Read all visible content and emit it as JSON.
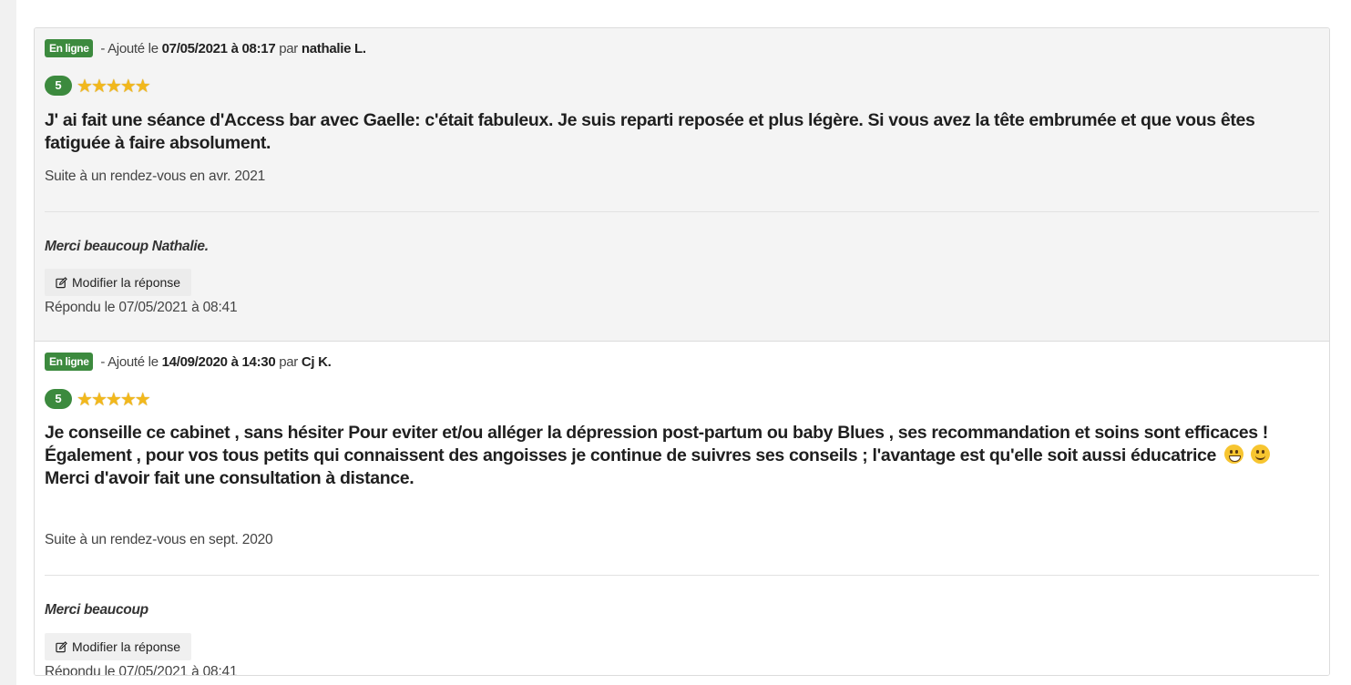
{
  "reviews": [
    {
      "status_badge": "En ligne",
      "added_prefix": " - Ajouté le ",
      "date": "07/05/2021 à 08:17",
      "by": " par ",
      "author": "nathalie L.",
      "rating": "5",
      "stars": [
        "★",
        "★",
        "★",
        "★",
        "★"
      ],
      "text": "J' ai fait une séance d'Access bar avec Gaelle: c'était fabuleux. Je suis reparti reposée et plus légère. Si vous avez la tête embrumée et que vous êtes fatiguée à faire absolument.",
      "appointment": "Suite à un rendez-vous en avr. 2021",
      "reply": "Merci beaucoup Nathalie.",
      "edit_label": "Modifier la réponse",
      "answered": "Répondu le 07/05/2021 à 08:41"
    },
    {
      "status_badge": "En ligne",
      "added_prefix": " - Ajouté le ",
      "date": "14/09/2020 à 14:30",
      "by": " par ",
      "author": "Cj K.",
      "rating": "5",
      "stars": [
        "★",
        "★",
        "★",
        "★",
        "★"
      ],
      "text_part1": "Je conseille ce cabinet , sans hésiter Pour eviter et/ou alléger la dépression post-partum ou baby Blues , ses recommandation et soins sont efficaces ! Également , pour vos tous petits qui connaissent des angoisses je continue de suivres ses conseils ; l'avantage est qu'elle soit aussi éducatrice",
      "emoji1": "grinning-face-emoji",
      "emoji2": "winking-face-emoji",
      "text_part2": " Merci d'avoir fait une consultation à distance.",
      "appointment": "Suite à un rendez-vous en sept. 2020",
      "reply": "Merci beaucoup",
      "edit_label": "Modifier la réponse",
      "answered": "Répondu le 07/05/2021 à 08:41"
    }
  ],
  "colors": {
    "badge_green": "#3c8a3e",
    "star_gold": "#f2b81c"
  },
  "icons": {
    "edit": "edit-icon",
    "star": "star-icon"
  }
}
